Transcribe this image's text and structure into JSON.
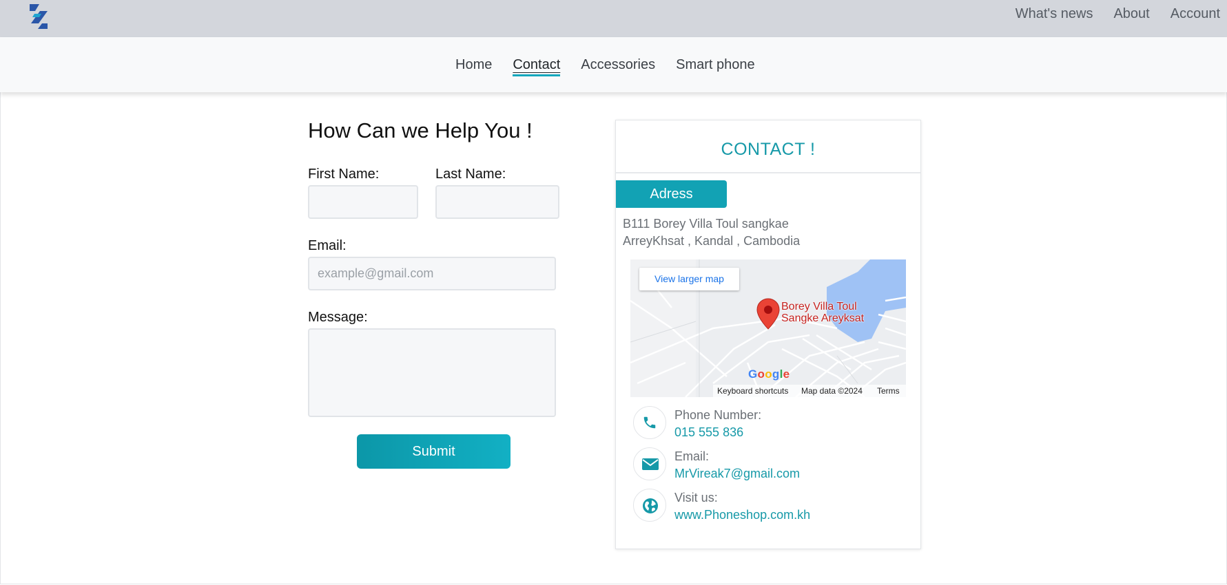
{
  "topbar": {
    "links": [
      "What's news",
      "About",
      "Account"
    ]
  },
  "nav": {
    "items": [
      "Home",
      "Contact",
      "Accessories",
      "Smart phone"
    ],
    "active": "Contact"
  },
  "form": {
    "title": "How Can we Help You !",
    "first_name_label": "First Name:",
    "last_name_label": "Last Name:",
    "email_label": "Email:",
    "email_placeholder": "example@gmail.com",
    "message_label": "Message:",
    "submit_label": "Submit"
  },
  "contact": {
    "title": "CONTACT !",
    "address_tab": "Adress",
    "address_lines": [
      "B111 Borey Villa Toul sangkae",
      "ArreyKhsat , Kandal , Cambodia"
    ],
    "map": {
      "view_larger": "View larger map",
      "place_line1": "Borey Villa Toul",
      "place_line2": "Sangke Areyksat",
      "google": "Google",
      "keyboard_shortcuts": "Keyboard shortcuts",
      "map_data": "Map data ©2024",
      "terms": "Terms"
    },
    "phone_label": "Phone Number:",
    "phone_value": "015 555 836",
    "email_label": "Email:",
    "email_value": "MrVireak7@gmail.com",
    "visit_label": "Visit us:",
    "visit_value": "www.Phoneshop.com.kh"
  },
  "colors": {
    "accent": "#12a7bd",
    "topbar_bg": "#d3d6dc",
    "nav_bg": "#f8f9fa"
  }
}
